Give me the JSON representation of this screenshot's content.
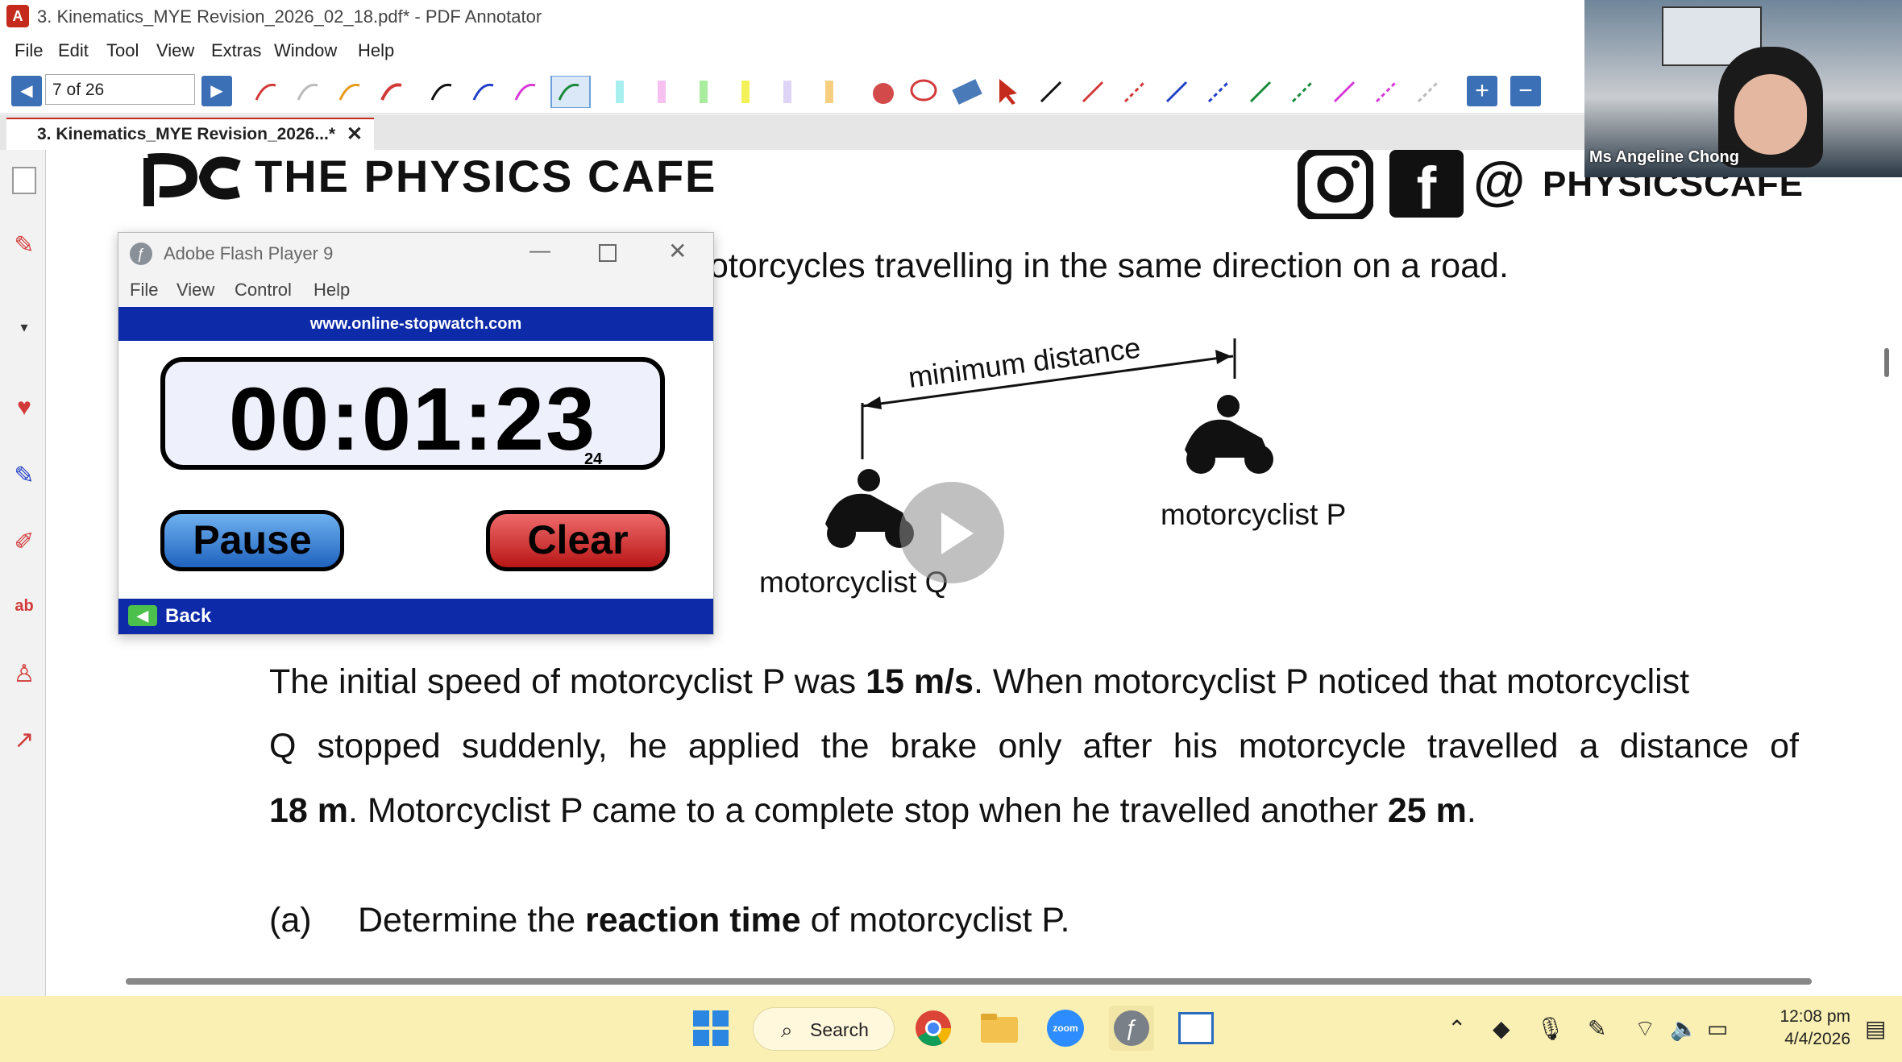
{
  "window": {
    "title": "3. Kinematics_MYE Revision_2026_02_18.pdf* - PDF Annotator",
    "menus": [
      "File",
      "Edit",
      "Tool",
      "View",
      "Extras",
      "Window",
      "Help"
    ]
  },
  "toolbar": {
    "page_indicator": "7 of 26",
    "prev_icon": "triangle-left-icon",
    "next_icon": "triangle-right-icon"
  },
  "tabs": [
    {
      "label": "3. Kinematics_MYE Revision_2026...*",
      "close": "✕"
    }
  ],
  "document": {
    "brand": "THE PHYSICS CAFE",
    "brand_logo": "pc",
    "social_handle": "PHYSICSCAFE",
    "social_at": "@",
    "intro_line": "otorcycles travelling in the same direction on a road.",
    "diagram": {
      "distance_label": "minimum distance",
      "label_p": "motorcyclist P",
      "label_q": "motorcyclist Q"
    },
    "paragraph": {
      "line1_pre": "The initial speed of motorcyclist P was ",
      "line1_bold": "15 m/s",
      "line1_post": ". When motorcyclist P noticed that motorcyclist",
      "line2": "Q stopped suddenly, he applied the brake only after his motorcycle travelled a distance of",
      "line3_bold1": "18 m",
      "line3_mid": ". Motorcyclist P came to a complete stop when he travelled another ",
      "line3_bold2": "25 m",
      "line3_end": "."
    },
    "question_a": {
      "label": "(a)",
      "pre": "Determine the ",
      "bold": "reaction time",
      "post": " of motorcyclist P."
    }
  },
  "flash_player": {
    "title": "Adobe Flash Player 9",
    "menus": [
      "File",
      "View",
      "Control",
      "Help"
    ],
    "url": "www.online-stopwatch.com",
    "time": "00:01:23",
    "subseconds": "24",
    "pause_label": "Pause",
    "clear_label": "Clear",
    "back_label": "Back",
    "colors": {
      "header": "#0d2aa8",
      "pause": "#2f7bd1",
      "clear": "#c81e1e"
    }
  },
  "webcam": {
    "name": "Ms Angeline Chong"
  },
  "taskbar": {
    "search_label": "Search",
    "time": "12:08 pm",
    "date": "4/4/2026"
  },
  "colors": {
    "accent": "#c42b1c",
    "taskbar": "#faf0b4"
  }
}
